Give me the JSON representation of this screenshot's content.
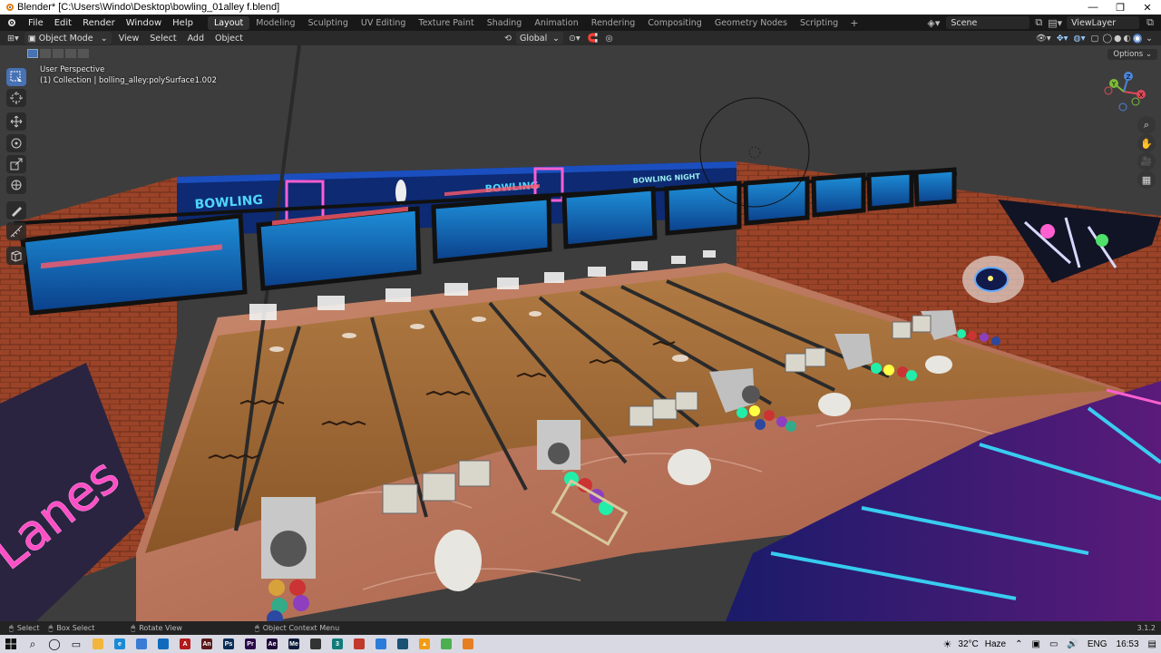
{
  "window": {
    "title": "Blender* [C:\\Users\\Windo\\Desktop\\bowling_01alley f.blend]",
    "controls": [
      "—",
      "❐",
      "✕"
    ]
  },
  "menus": [
    "File",
    "Edit",
    "Render",
    "Window",
    "Help"
  ],
  "workspaces": [
    {
      "label": "Layout",
      "active": true
    },
    {
      "label": "Modeling"
    },
    {
      "label": "Sculpting"
    },
    {
      "label": "UV Editing"
    },
    {
      "label": "Texture Paint"
    },
    {
      "label": "Shading"
    },
    {
      "label": "Animation"
    },
    {
      "label": "Rendering"
    },
    {
      "label": "Compositing"
    },
    {
      "label": "Geometry Nodes"
    },
    {
      "label": "Scripting"
    }
  ],
  "workspace_add": "+",
  "scene": {
    "name": "Scene",
    "view_layer": "ViewLayer"
  },
  "header": {
    "mode": "Object Mode",
    "view": "View",
    "select": "Select",
    "add": "Add",
    "object": "Object",
    "transform_orientation": "Global",
    "options": "Options"
  },
  "viewport": {
    "perspective": "User Perspective",
    "collection": "(1) Collection | bolling_alley:polySurface1.002",
    "sign_text": "Lanes",
    "poster_texts": [
      "BOWLING",
      "BOWLING",
      "BOWLING NIGHT"
    ],
    "gizmo_axes": {
      "x": "X",
      "y": "Y",
      "z": "Z"
    }
  },
  "tools": [
    "select-box",
    "cursor",
    "move",
    "rotate",
    "scale",
    "transform",
    "annotate",
    "measure",
    "add-cube"
  ],
  "statusbar": {
    "select": "Select",
    "box_select": "Box Select",
    "rotate_view": "Rotate View",
    "context_menu": "Object Context Menu",
    "version": "3.1.2"
  },
  "taskbar": {
    "weather": "32°C",
    "weather_desc": "Haze",
    "language": "ENG",
    "time": "16:53",
    "pinned_apps": [
      {
        "name": "file-explorer",
        "color": "#f3b53a",
        "glyph": ""
      },
      {
        "name": "edge",
        "color": "#1b8ad6",
        "glyph": "e"
      },
      {
        "name": "store",
        "color": "#3a7bd5",
        "glyph": ""
      },
      {
        "name": "mail",
        "color": "#0f6cbd",
        "glyph": ""
      },
      {
        "name": "acrobat",
        "color": "#b31b1b",
        "glyph": "A"
      },
      {
        "name": "animate",
        "color": "#5a1a1a",
        "glyph": "An"
      },
      {
        "name": "photoshop",
        "color": "#0b2d57",
        "glyph": "Ps"
      },
      {
        "name": "premiere",
        "color": "#2a0b4a",
        "glyph": "Pr"
      },
      {
        "name": "after-effects",
        "color": "#1e0b3a",
        "glyph": "Ae"
      },
      {
        "name": "media-encoder",
        "color": "#0e1c3a",
        "glyph": "Me"
      },
      {
        "name": "inkscape",
        "color": "#333333",
        "glyph": ""
      },
      {
        "name": "3d-app",
        "color": "#117a7a",
        "glyph": "3"
      },
      {
        "name": "sketchup",
        "color": "#c0392b",
        "glyph": ""
      },
      {
        "name": "maps",
        "color": "#2b7bd9",
        "glyph": ""
      },
      {
        "name": "game-app",
        "color": "#1a5276",
        "glyph": ""
      },
      {
        "name": "vlc",
        "color": "#f39c12",
        "glyph": "▲"
      },
      {
        "name": "chrome",
        "color": "#4caf50",
        "glyph": ""
      },
      {
        "name": "blender",
        "color": "#e67e22",
        "glyph": ""
      }
    ]
  }
}
